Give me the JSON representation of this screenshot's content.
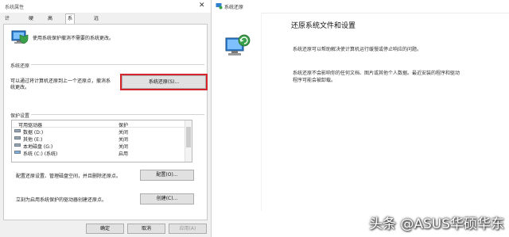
{
  "left_dialog": {
    "title": "系统属性",
    "tabs": [
      "计算机名",
      "硬件",
      "高级",
      "系统保护",
      "远程"
    ],
    "intro": "使用系统保护撤消不需要的系统更改。",
    "restore_section": {
      "label": "系统还原",
      "desc_line1": "可以通过将计算机还原到上一个还原点，撤消系",
      "desc_line2": "统更改。",
      "button": "系统还原(S)..."
    },
    "protection_section": {
      "label": "保护设置",
      "columns": [
        "可用驱动器",
        "保护"
      ],
      "rows": [
        {
          "drive": "数据 (D:)",
          "status": "关闭"
        },
        {
          "drive": "其他 (E:)",
          "status": "关闭"
        },
        {
          "drive": "本地磁盘 (G:)",
          "status": "关闭"
        },
        {
          "drive": "系统 (C:) (系统)",
          "status": "启用"
        }
      ],
      "configure_text": "配置还原设置、管理磁盘空间，并且删除还原点。",
      "configure_button": "配置(O)...",
      "create_text": "立刻为启用系统保护的驱动器创建还原点。",
      "create_button": "创建(C)..."
    },
    "footer": {
      "ok": "确定",
      "cancel": "取消",
      "apply": "应用(A)"
    }
  },
  "right_dialog": {
    "title": "系统还原",
    "heading": "还原系统文件和设置",
    "para1": "系统还原可以帮助解决使计算机运行缓慢或停止响应的问题。",
    "para2_line1": "系统还原不会影响你的任何文档、图片或其他个人数据。最近安装的程序和驱动",
    "para2_line2": "程序可能会被卸载。"
  },
  "watermark": "头条 @ASUS华硕华东",
  "colors": {
    "highlight": "#d6242d",
    "dialog_bg": "#f0f0f0"
  }
}
